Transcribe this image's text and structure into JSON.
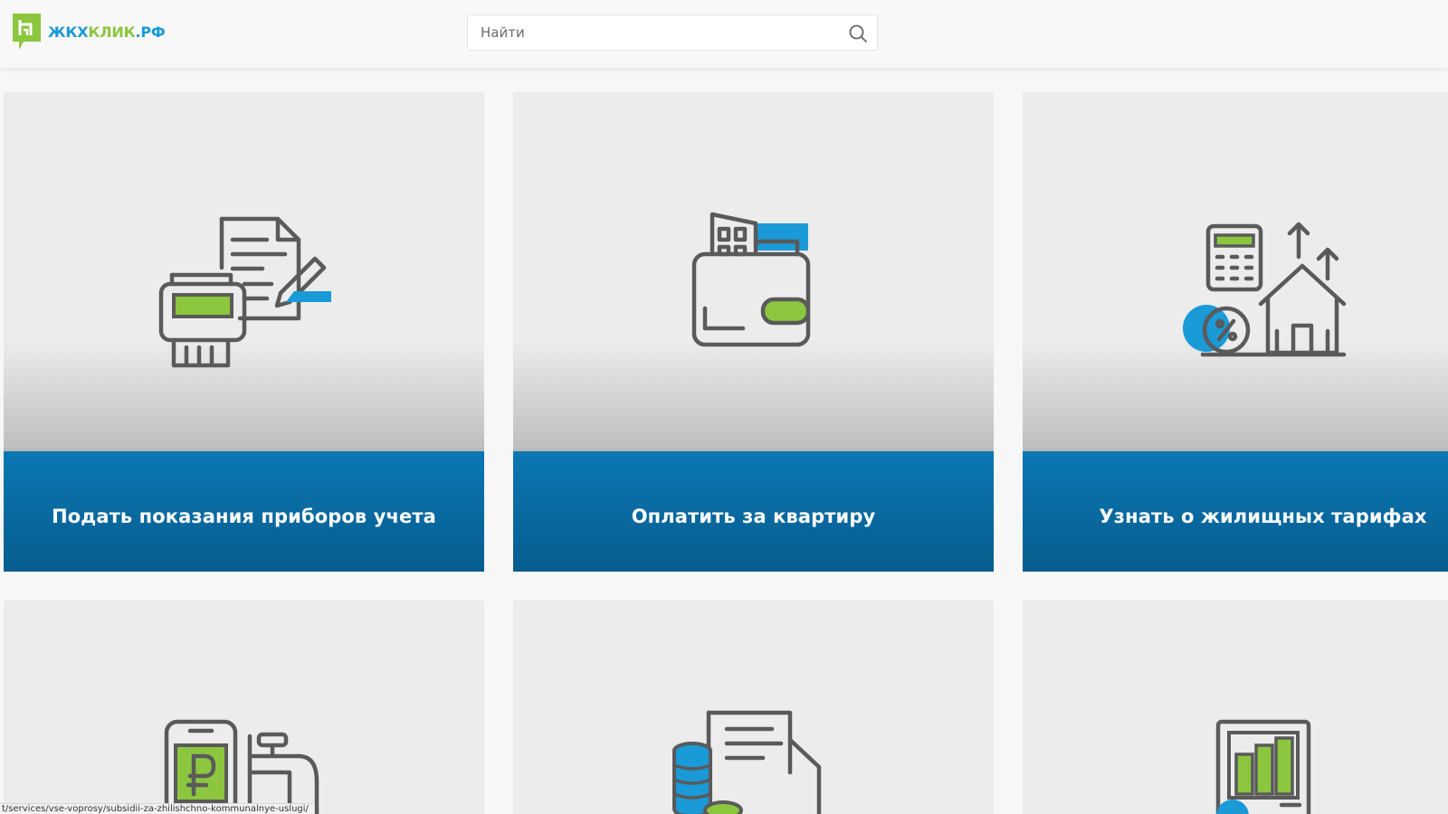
{
  "header": {
    "logo": {
      "part_a": "ЖКХ",
      "part_b": "КЛИК",
      "part_c": ".РФ"
    },
    "search": {
      "placeholder": "Найти"
    }
  },
  "colors": {
    "brand_blue": "#1a9ad6",
    "brand_green": "#8cc63f",
    "band_blue": "#0a77b3",
    "icon_gray": "#5a5a5a"
  },
  "cards": [
    {
      "title": "Подать показания приборов учета",
      "icon": "meter-document-icon"
    },
    {
      "title": "Оплатить за квартиру",
      "icon": "wallet-building-icon"
    },
    {
      "title": "Узнать о жилищных тарифах",
      "icon": "calculator-house-tariff-icon"
    }
  ],
  "cards_bottom": [
    {
      "icon": "phone-ruble-faucet-icon"
    },
    {
      "icon": "coins-envelope-icon"
    },
    {
      "icon": "building-document-icon"
    }
  ],
  "status_bar": {
    "url": "t/services/vse-voprosy/subsidii-za-zhilishchno-kommunalnye-uslugi/"
  }
}
